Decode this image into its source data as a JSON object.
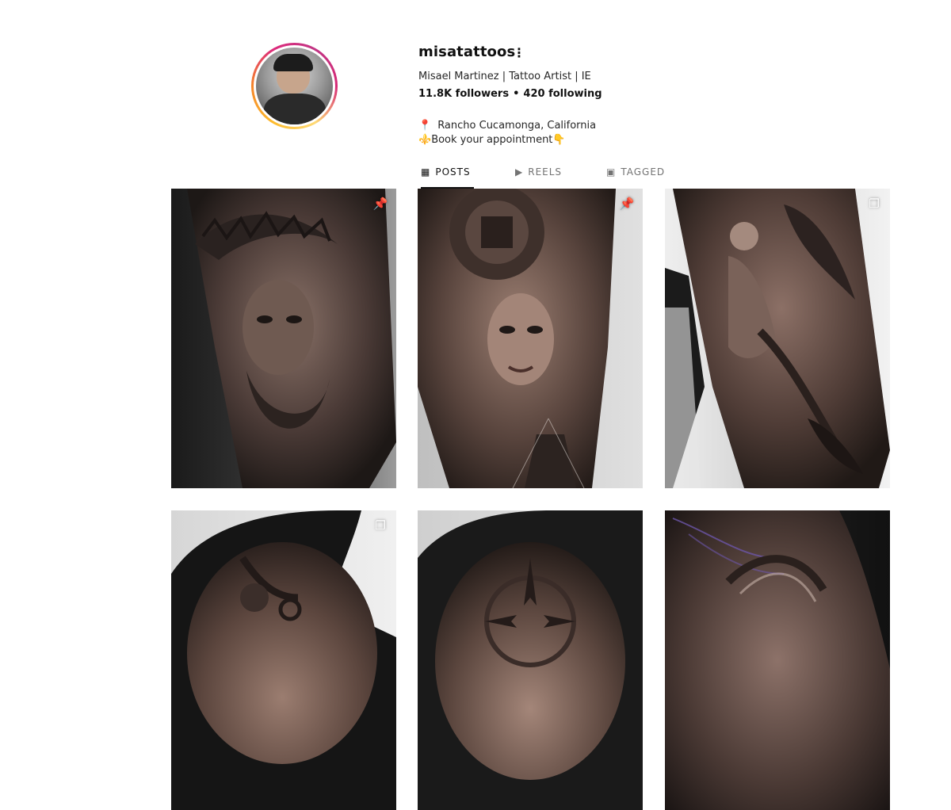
{
  "profile": {
    "username": "misatattoos",
    "more_icon": "more-options-icon",
    "full_name": "Misael Martinez | Tattoo Artist | IE",
    "followers": "11.8K followers",
    "separator": "•",
    "following": "420 following",
    "bio": {
      "pin_emoji": "📍",
      "location": "Rancho Cucamonga, California",
      "appointment_emoji": "⚜️",
      "appointment": "Book your appointment",
      "pointing_emoji": "👇"
    }
  },
  "tabs": [
    {
      "label": "POSTS",
      "icon": "grid-icon",
      "glyph": "▦",
      "active": true
    },
    {
      "label": "REELS",
      "icon": "reels-icon",
      "glyph": "▶",
      "active": false
    },
    {
      "label": "TAGGED",
      "icon": "tagged-icon",
      "glyph": "▣",
      "active": false
    }
  ],
  "posts": [
    {
      "badge": "pinned-icon",
      "badge_glyph": "📌",
      "subject": "Jesus crown of thorns forearm tattoo"
    },
    {
      "badge": "pinned-icon",
      "badge_glyph": "📌",
      "subject": "Aztec woman and calendar forearm tattoo"
    },
    {
      "badge": "carousel-icon",
      "badge_glyph": "❐",
      "subject": "Angel forearm tattoo"
    },
    {
      "badge": "carousel-icon",
      "badge_glyph": "❐",
      "subject": "Chain and roses shoulder tattoo"
    },
    {
      "badge": "",
      "badge_glyph": "",
      "subject": "Sun mandala shoulder tattoo"
    },
    {
      "badge": "",
      "badge_glyph": "",
      "subject": "Aztec shield arm tattoo"
    }
  ],
  "colors": {
    "ring_start": "#fdbb2d",
    "ring_mid": "#dd2a7b",
    "ring_end": "#c13584",
    "tab_active": "#111111",
    "tab_inactive": "#737373"
  }
}
